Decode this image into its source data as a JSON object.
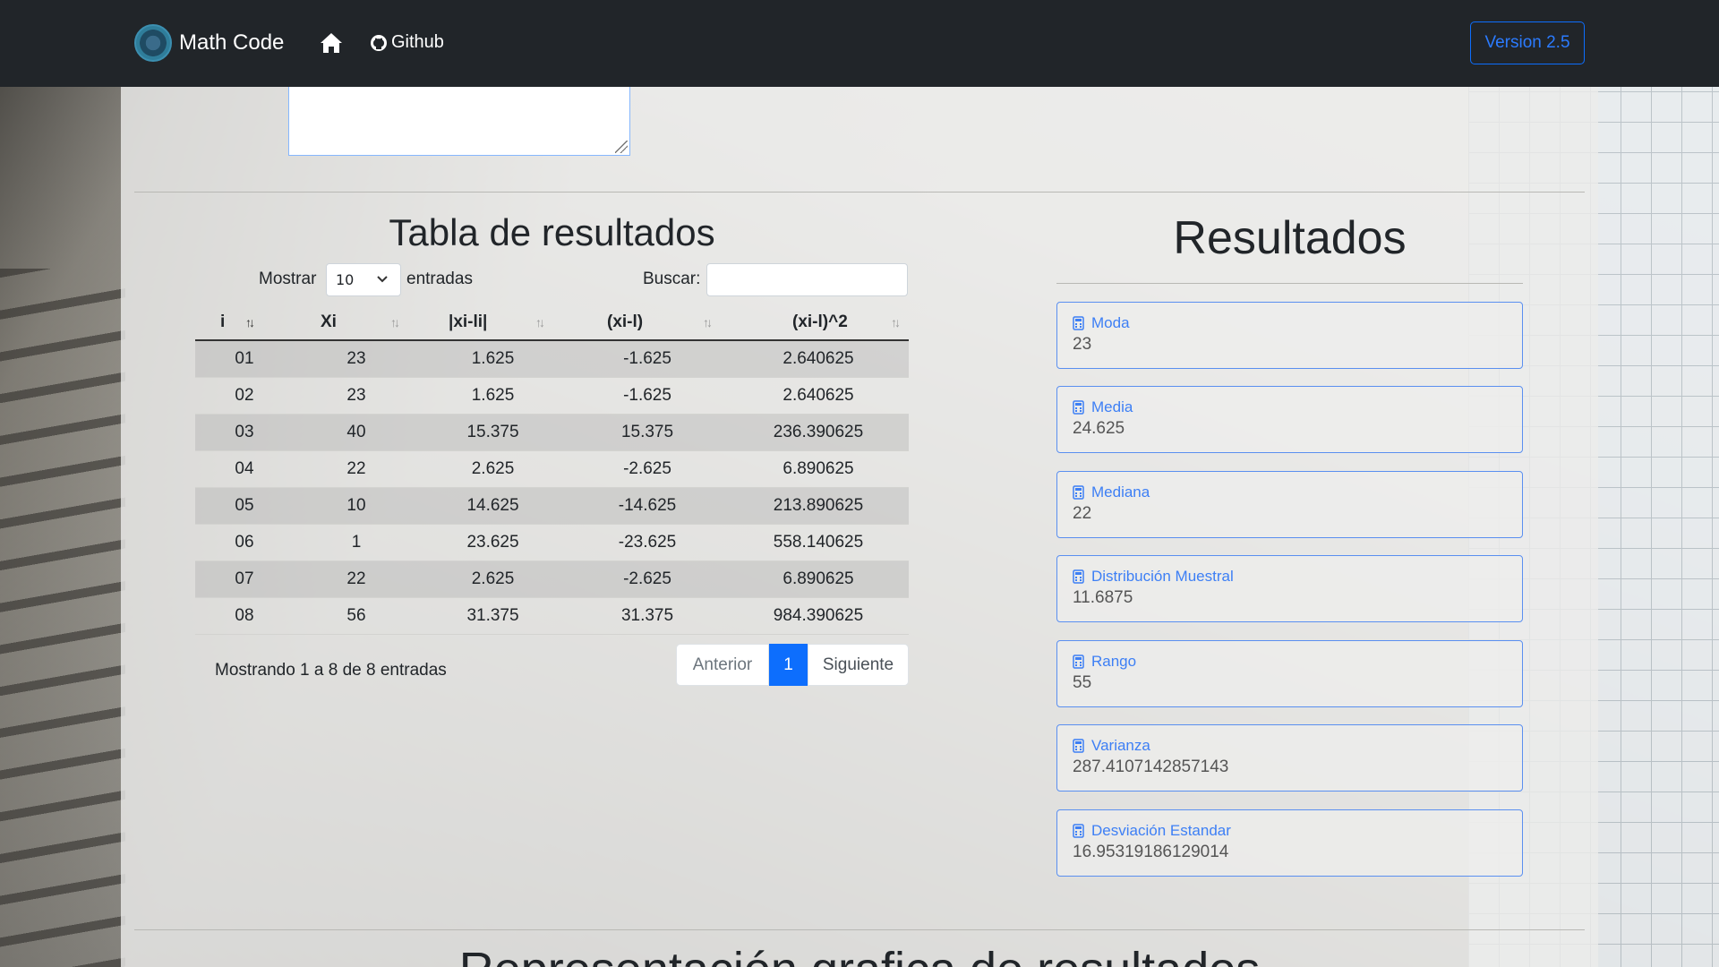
{
  "navbar": {
    "brand": "Math Code",
    "github": "Github",
    "version": "Version 2.5"
  },
  "table": {
    "title": "Tabla de resultados",
    "length_label": "Mostrar",
    "length_value": "10",
    "length_suffix": "entradas",
    "search_label": "Buscar:",
    "search_value": "",
    "columns": [
      "i",
      "Xi",
      "|xi-li|",
      "(xi-l)",
      "(xi-l)^2"
    ],
    "rows": [
      [
        "01",
        "23",
        "1.625",
        "-1.625",
        "2.640625"
      ],
      [
        "02",
        "23",
        "1.625",
        "-1.625",
        "2.640625"
      ],
      [
        "03",
        "40",
        "15.375",
        "15.375",
        "236.390625"
      ],
      [
        "04",
        "22",
        "2.625",
        "-2.625",
        "6.890625"
      ],
      [
        "05",
        "10",
        "14.625",
        "-14.625",
        "213.890625"
      ],
      [
        "06",
        "1",
        "23.625",
        "-23.625",
        "558.140625"
      ],
      [
        "07",
        "22",
        "2.625",
        "-2.625",
        "6.890625"
      ],
      [
        "08",
        "56",
        "31.375",
        "31.375",
        "984.390625"
      ]
    ],
    "info": "Mostrando 1 a 8 de 8 entradas",
    "pagination": {
      "prev": "Anterior",
      "current": "1",
      "next": "Siguiente"
    }
  },
  "results": {
    "title": "Resultados",
    "cards": [
      {
        "label": "Moda",
        "value": "23"
      },
      {
        "label": "Media",
        "value": "24.625"
      },
      {
        "label": "Mediana",
        "value": "22"
      },
      {
        "label": "Distribución Muestral",
        "value": "11.6875"
      },
      {
        "label": "Rango",
        "value": "55"
      },
      {
        "label": "Varianza",
        "value": "287.4107142857143"
      },
      {
        "label": "Desviación Estandar",
        "value": "16.95319186129014"
      }
    ]
  },
  "bottom_heading": "Representación grafica de resultados",
  "colors": {
    "navbar": "#212529",
    "primary": "#0d6efd",
    "card_border": "#5a8ff0"
  },
  "icons": {
    "home": "home-icon",
    "github": "github-icon",
    "card": "calculator-icon",
    "select": "chevron-down-icon"
  }
}
